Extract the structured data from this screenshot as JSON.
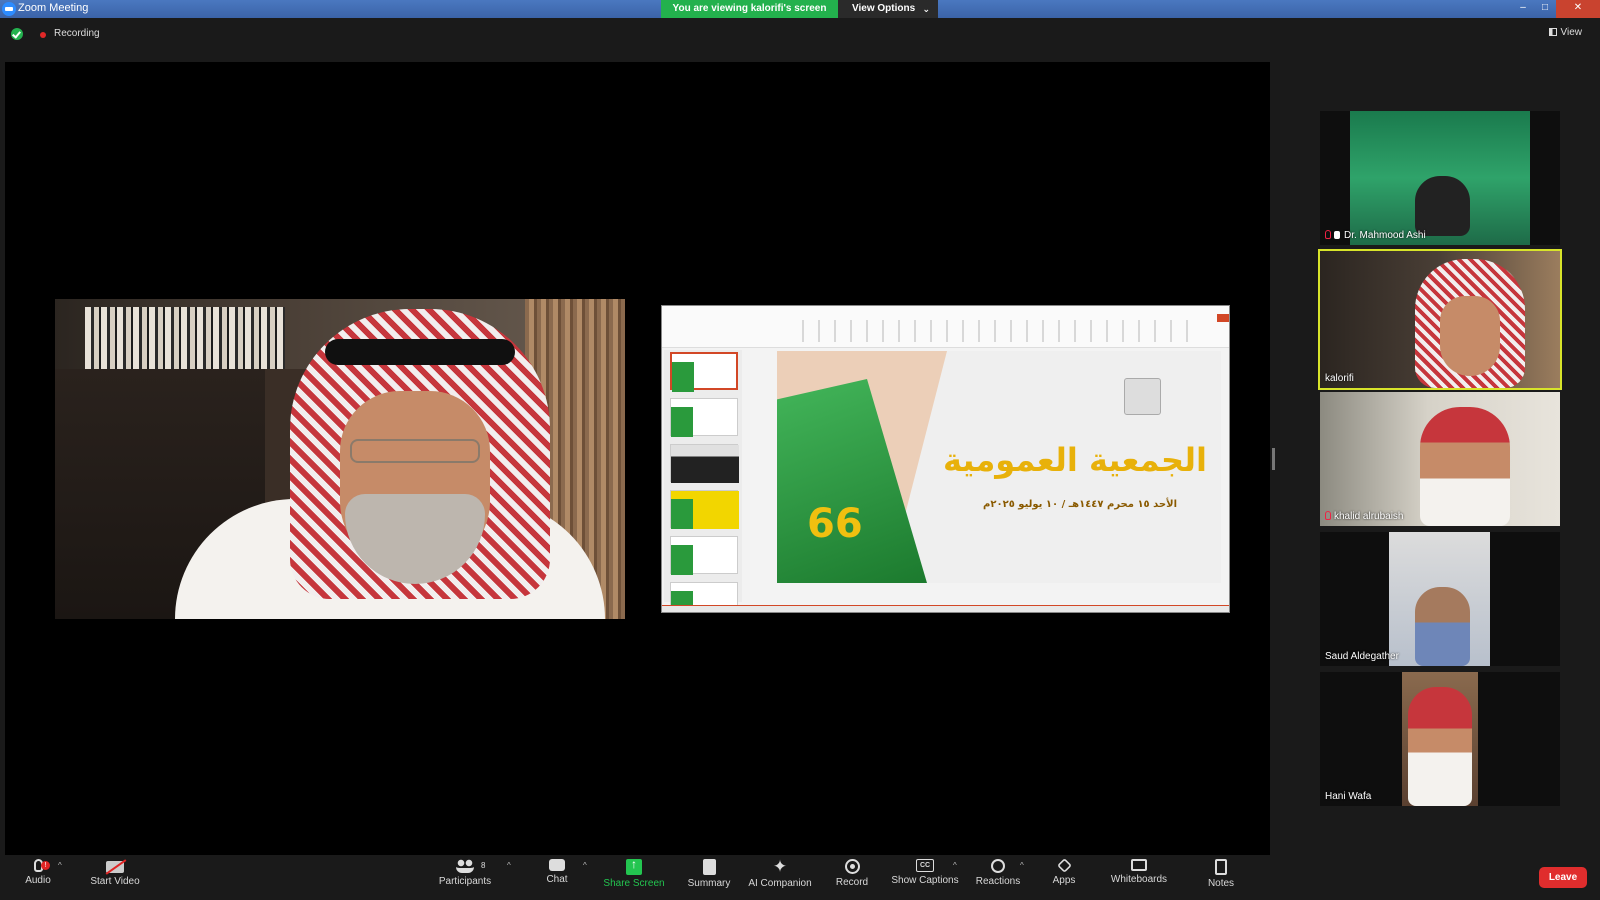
{
  "window": {
    "title": "Zoom Meeting",
    "viewing_banner": "You are viewing kalorifi's screen",
    "view_options": "View Options",
    "controls": [
      "–",
      "□",
      "✕"
    ]
  },
  "top": {
    "recording": "Recording",
    "view": "View"
  },
  "share": {
    "slide_number": "66",
    "slide_title": "الجمعية العمومية",
    "slide_subtitle": "الأحد ١٥ محرم ١٤٤٧هـ / ١٠ يوليو ٢٠٢٥م"
  },
  "gallery": [
    {
      "name": "Dr. Mahmood Ashi",
      "muted": true,
      "pinned": true,
      "active": false
    },
    {
      "name": "kalorifi",
      "muted": false,
      "pinned": false,
      "active": true
    },
    {
      "name": "khalid alrubaish",
      "muted": true,
      "pinned": false,
      "active": false
    },
    {
      "name": "Saud Aldegather",
      "muted": false,
      "pinned": false,
      "active": false
    },
    {
      "name": "Hani Wafa",
      "muted": false,
      "pinned": false,
      "active": false
    }
  ],
  "toolbar": {
    "audio": "Audio",
    "audio_badge": "!",
    "start_video": "Start Video",
    "participants": "Participants",
    "participants_count": "8",
    "chat": "Chat",
    "share_screen": "Share Screen",
    "summary": "Summary",
    "ai_companion": "AI Companion",
    "record": "Record",
    "show_captions": "Show Captions",
    "reactions": "Reactions",
    "apps": "Apps",
    "whiteboards": "Whiteboards",
    "notes": "Notes",
    "leave": "Leave",
    "accent_green": "#23c550",
    "leave_red": "#e02d2d"
  }
}
